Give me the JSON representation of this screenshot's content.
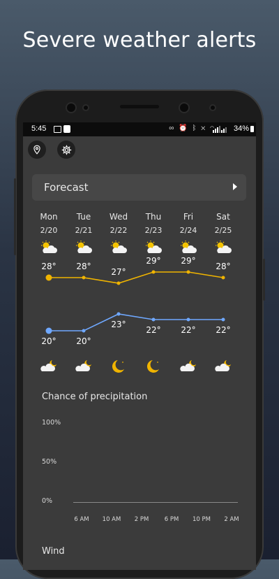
{
  "headline": "Severe weather alerts",
  "status_bar": {
    "time": "5:45",
    "battery": "34%",
    "left_icons": [
      "image-icon",
      "app-icon"
    ],
    "right_icons": [
      "glasses-icon",
      "alarm-icon",
      "bluetooth-icon",
      "mute-icon",
      "wifi-icon",
      "signal-icon",
      "signal-icon"
    ]
  },
  "toolbar": {
    "location_icon": "location-pin-icon",
    "settings_icon": "gear-icon"
  },
  "forecast": {
    "title": "Forecast",
    "days": [
      {
        "name": "Mon",
        "date": "2/20",
        "day_icon": "partly-cloudy-icon",
        "high": "28°",
        "low": "20°",
        "night_icon": "cloudy-night-icon"
      },
      {
        "name": "Tue",
        "date": "2/21",
        "day_icon": "partly-cloudy-icon",
        "high": "28°",
        "low": "20°",
        "night_icon": "cloudy-night-icon"
      },
      {
        "name": "Wed",
        "date": "2/22",
        "day_icon": "partly-cloudy-icon",
        "high": "27°",
        "low": "23°",
        "night_icon": "clear-night-icon"
      },
      {
        "name": "Thu",
        "date": "2/23",
        "day_icon": "partly-cloudy-icon",
        "high": "29°",
        "low": "22°",
        "night_icon": "clear-night-icon"
      },
      {
        "name": "Fri",
        "date": "2/24",
        "day_icon": "partly-cloudy-icon",
        "high": "29°",
        "low": "22°",
        "night_icon": "cloudy-night-icon"
      },
      {
        "name": "Sat",
        "date": "2/25",
        "day_icon": "partly-cloudy-icon",
        "high": "28°",
        "low": "22°",
        "night_icon": "cloudy-night-icon"
      }
    ],
    "highs": [
      28,
      28,
      27,
      29,
      29,
      28
    ],
    "lows": [
      20,
      20,
      23,
      22,
      22,
      22
    ]
  },
  "precipitation": {
    "title": "Chance of precipitation",
    "y_labels": [
      "100%",
      "50%",
      "0%"
    ],
    "hours": [
      "6 AM",
      "10 AM",
      "2 PM",
      "6 PM",
      "10 PM",
      "2 AM"
    ]
  },
  "wind": {
    "title": "Wind"
  },
  "colors": {
    "high_line": "#f0b400",
    "low_line": "#6fa8ff",
    "night_icon": "#f0b400"
  }
}
